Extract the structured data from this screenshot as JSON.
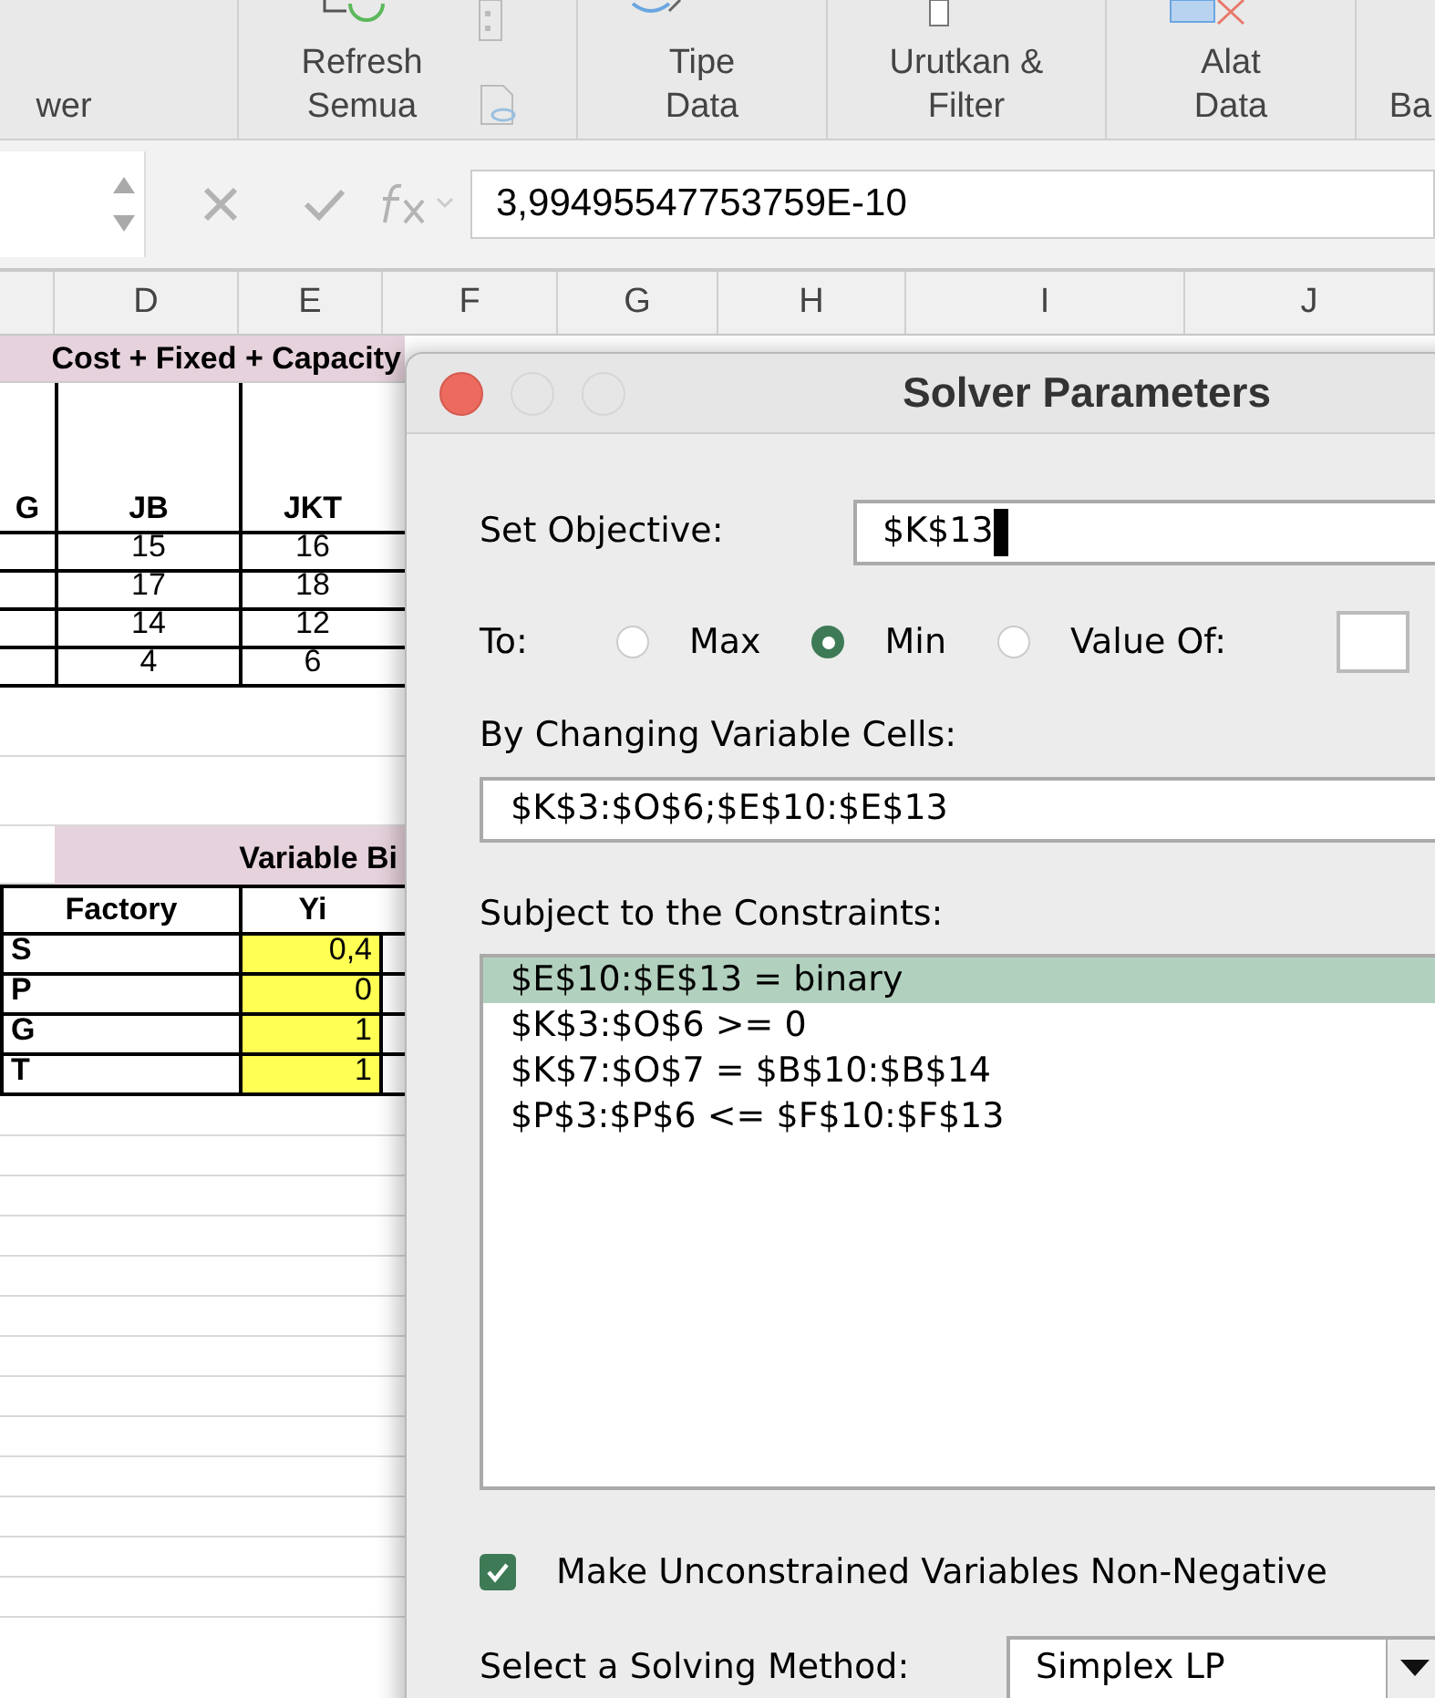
{
  "ribbon": {
    "groups": [
      {
        "label": "wer"
      },
      {
        "label": "Refresh\nSemua"
      },
      {
        "label": "Tipe\nData"
      },
      {
        "label": "Urutkan &\nFilter"
      },
      {
        "label": "Alat\nData"
      },
      {
        "label": "Ba"
      }
    ]
  },
  "formula_bar": {
    "value": "3,99495547753759E-10"
  },
  "column_headers": [
    "D",
    "E",
    "F",
    "G",
    "H",
    "I",
    "J"
  ],
  "cost_table": {
    "title": "Cost + Fixed + Capacity",
    "columns": [
      "G",
      "JB",
      "JKT"
    ],
    "rows": [
      [
        "",
        "15",
        "16"
      ],
      [
        "",
        "17",
        "18"
      ],
      [
        "",
        "14",
        "12"
      ],
      [
        "",
        "4",
        "6"
      ]
    ]
  },
  "binary_table": {
    "title": "Variable Bi",
    "columns": [
      "Factory",
      "Yi"
    ],
    "rows": [
      [
        "S",
        "0,4"
      ],
      [
        "P",
        "0"
      ],
      [
        "G",
        "1"
      ],
      [
        "T",
        "1"
      ]
    ]
  },
  "dialog": {
    "title": "Solver Parameters",
    "objective": {
      "label": "Set Objective:",
      "value": "$K$13"
    },
    "to": {
      "label": "To:",
      "options": [
        {
          "label": "Max",
          "selected": false
        },
        {
          "label": "Min",
          "selected": true
        },
        {
          "label": "Value Of:",
          "selected": false
        }
      ]
    },
    "changing": {
      "label": "By Changing Variable Cells:",
      "value": "$K$3:$O$6;$E$10:$E$13"
    },
    "constraints": {
      "label": "Subject to the Constraints:",
      "items": [
        {
          "text": "$E$10:$E$13 = binary",
          "selected": true
        },
        {
          "text": "$K$3:$O$6 >= 0",
          "selected": false
        },
        {
          "text": "$K$7:$O$7 = $B$10:$B$14",
          "selected": false
        },
        {
          "text": "$P$3:$P$6 <= $F$10:$F$13",
          "selected": false
        }
      ]
    },
    "nonneg": {
      "label": "Make Unconstrained Variables Non-Negative",
      "checked": true
    },
    "method": {
      "label": "Select a Solving Method:",
      "value": "Simplex LP"
    }
  }
}
